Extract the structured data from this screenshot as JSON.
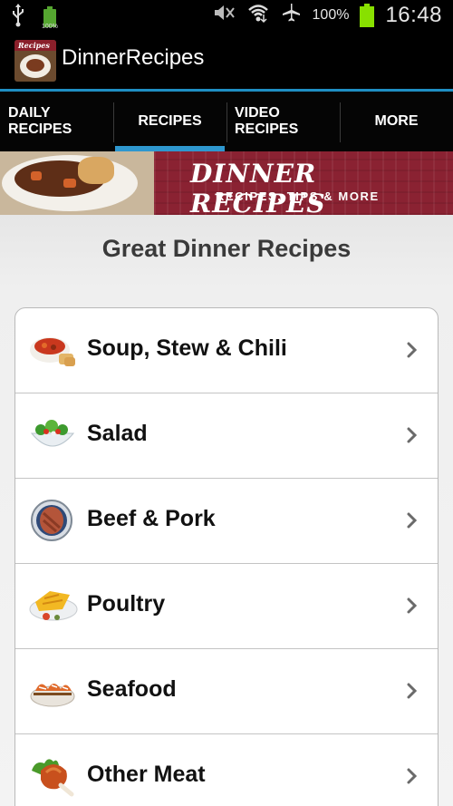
{
  "status_bar": {
    "battery_small_label": "100%",
    "battery_percent": "100%",
    "time": "16:48",
    "icons": [
      "usb-icon",
      "battery-icon",
      "mute-icon",
      "wifi-icon",
      "airplane-icon",
      "battery-icon"
    ]
  },
  "action_bar": {
    "app_icon_text": "Recipes",
    "title": "DinnerRecipes"
  },
  "tabs": [
    {
      "label": "DAILY\nRECIPES",
      "active": false
    },
    {
      "label": "RECIPES",
      "active": true
    },
    {
      "label": "VIDEO\nRECIPES",
      "active": false
    },
    {
      "label": "MORE",
      "active": false
    }
  ],
  "banner": {
    "title": "DINNER RECIPES",
    "subtitle": "RECIPES, TIPS & MORE"
  },
  "main": {
    "heading": "Great Dinner Recipes",
    "categories": [
      {
        "label": "Soup, Stew & Chili",
        "icon": "soup-icon"
      },
      {
        "label": "Salad",
        "icon": "salad-icon"
      },
      {
        "label": "Beef & Pork",
        "icon": "steak-icon"
      },
      {
        "label": "Poultry",
        "icon": "poultry-icon"
      },
      {
        "label": "Seafood",
        "icon": "seafood-icon"
      },
      {
        "label": "Other Meat",
        "icon": "meat-icon"
      }
    ]
  },
  "colors": {
    "accent": "#2e97cf",
    "banner": "#8a2232",
    "battery": "#88e000"
  }
}
